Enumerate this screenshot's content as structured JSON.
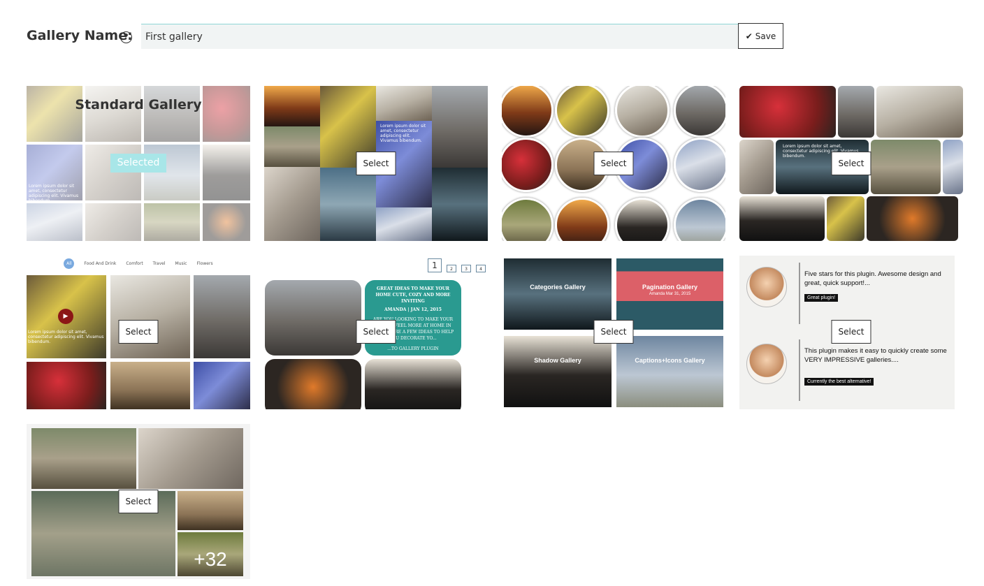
{
  "header": {
    "label": "Gallery Name:",
    "help_icon": "?",
    "input_value": "First gallery",
    "save_label": "Save",
    "save_icon": "✔"
  },
  "tiles": {
    "standard": {
      "title": "Standard Gallery",
      "badge": "Selected",
      "caption": "Lorem ipsum dolor sit amet, consectetur adipiscing elit. Vivamus bibendum."
    },
    "mosaic": {
      "select": "Select",
      "caption": "Lorem ipsum dolor sit amet, consectetur adipiscing elit. Vivamus bibendum."
    },
    "circles": {
      "select": "Select"
    },
    "rounded": {
      "select": "Select",
      "caption": "Lorem ipsum dolor sit amet, consectetur adipiscing elit. Vivamus bibendum."
    },
    "filterable": {
      "select": "Select",
      "filters": [
        "All",
        "Food And Drink",
        "Comfort",
        "Travel",
        "Music",
        "Flowers"
      ],
      "play_icon": "▶",
      "caption": "Lorem ipsum dolor sit amet, consectetur adipiscing elit. Vivamus bibendum."
    },
    "paginated": {
      "select": "Select",
      "pages": [
        "1",
        "2",
        "3",
        "4"
      ],
      "card_title": "GREAT IDEAS TO MAKE YOUR HOME CUTE, COZY AND MORE INVITING",
      "card_date": "AMANDA | JAN 12, 2015",
      "card_body": "ARE YOU LOOKING TO MAKE YOUR GUESTS FEEL MORE AT HOME IN YOUR ... ARE A FEW IDEAS TO HELP YOU DECORATE YO...",
      "card_footer": "...TO GALLERY PLUGIN"
    },
    "categories": {
      "select": "Select",
      "labels": [
        "Categories Gallery",
        "Pagination Gallery",
        "Shadow Gallery",
        "Captions+Icons Gallery"
      ],
      "pagination_sub": "Amanda   Mar 31, 2015"
    },
    "testimonials": {
      "select": "Select",
      "items": [
        {
          "text": "Five stars for this plugin. Awesome design and great, quick support!...",
          "badge": "Great plugin!"
        },
        {
          "text": "This plugin makes it easy to quickly create some VERY IMPRESSIVE galleries....",
          "badge": "Currently the best alternative!"
        }
      ]
    },
    "more": {
      "select": "Select",
      "count": "+32"
    }
  }
}
